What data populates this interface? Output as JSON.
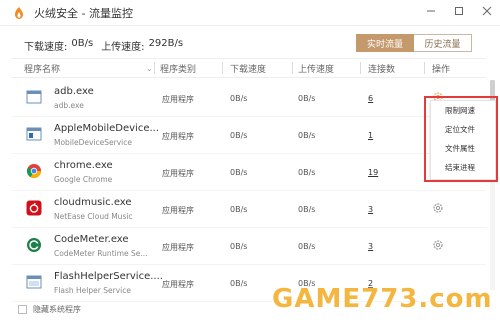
{
  "window": {
    "title": "火绒安全 - 流量监控",
    "controls": [
      "minimize-icon",
      "restore-icon",
      "close-icon"
    ]
  },
  "speed": {
    "download_label": "下载速度:",
    "download_value": "0B/s",
    "upload_label": "上传速度:",
    "upload_value": "292B/s"
  },
  "tabs": [
    {
      "label": "实时流量",
      "active": true
    },
    {
      "label": "历史流量",
      "active": false
    }
  ],
  "table": {
    "headers": [
      "程序名称",
      "程序类别",
      "下载速度",
      "上传速度",
      "连接数",
      "操作"
    ],
    "rows": [
      {
        "name": "adb.exe",
        "sub": "adb.exe",
        "type": "应用程序",
        "down": "0B/s",
        "up": "0B/s",
        "conn": "6",
        "icon": "window-app-icon"
      },
      {
        "name": "AppleMobileDevice...",
        "sub": "MobileDeviceService",
        "type": "应用程序",
        "down": "0B/s",
        "up": "0B/s",
        "conn": "1",
        "icon": "apple-device-icon"
      },
      {
        "name": "chrome.exe",
        "sub": "Google Chrome",
        "type": "应用程序",
        "down": "0B/s",
        "up": "0B/s",
        "conn": "19",
        "icon": "chrome-icon"
      },
      {
        "name": "cloudmusic.exe",
        "sub": "NetEase Cloud Music",
        "type": "应用程序",
        "down": "0B/s",
        "up": "0B/s",
        "conn": "3",
        "icon": "netease-music-icon"
      },
      {
        "name": "CodeMeter.exe",
        "sub": "CodeMeter Runtime Se...",
        "type": "应用程序",
        "down": "0B/s",
        "up": "0B/s",
        "conn": "3",
        "icon": "codemeter-icon"
      },
      {
        "name": "FlashHelperService....",
        "sub": "Flash Helper Service",
        "type": "应用程序",
        "down": "0B/s",
        "up": "0B/s",
        "conn": "2",
        "icon": "flash-helper-icon"
      }
    ]
  },
  "context_menu": {
    "items": [
      "限制网速",
      "定位文件",
      "文件属性",
      "结束进程"
    ],
    "highlight_color": "#e23b3b"
  },
  "footer": {
    "checkbox_label": "隐藏系统程序"
  },
  "watermark": {
    "text": "GAME773.com"
  },
  "colors": {
    "accent": "#c49a6c",
    "accent_text": "#8a6d4e"
  }
}
